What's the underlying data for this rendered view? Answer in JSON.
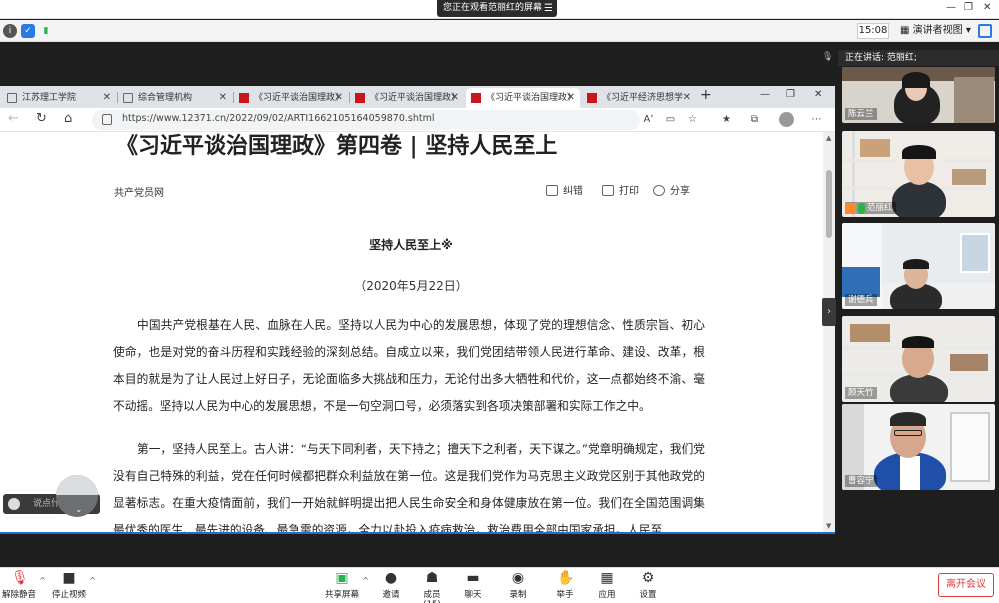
{
  "topbar": {
    "viewing_banner": "您正在观看范丽红的屏幕",
    "banner_menu": "☰",
    "time": "15:08",
    "speaker_view": "演讲者视图"
  },
  "browser": {
    "tabs": [
      {
        "label": "江苏理工学院",
        "favicon": "doc"
      },
      {
        "label": "综合管理机构",
        "favicon": "doc"
      },
      {
        "label": "《习近平谈治国理政》",
        "favicon": "red"
      },
      {
        "label": "《习近平谈治国理政》",
        "favicon": "red"
      },
      {
        "label": "《习近平谈治国理政》",
        "favicon": "red",
        "active": true
      },
      {
        "label": "《习近平经济思想学",
        "favicon": "red"
      }
    ],
    "url": "https://www.12371.cn/2022/09/02/ARTI1662105164059870.shtml",
    "read_aloud_label": "Aʼ"
  },
  "article": {
    "title": "《习近平谈治国理政》第四卷 | 坚持人民至上",
    "source": "共产党员网",
    "actions": {
      "correct": "纠错",
      "print": "打印",
      "share": "分享"
    },
    "subtitle": "坚持人民至上※",
    "date": "（2020年5月22日）",
    "para1": "中国共产党根基在人民、血脉在人民。坚持以人民为中心的发展思想，体现了党的理想信念、性质宗旨、初心使命，也是对党的奋斗历程和实践经验的深刻总结。自成立以来，我们党团结带领人民进行革命、建设、改革，根本目的就是为了让人民过上好日子，无论面临多大挑战和压力，无论付出多大牺牲和代价，这一点都始终不渝、毫不动摇。坚持以人民为中心的发展思想，不是一句空洞口号，必须落实到各项决策部署和实际工作之中。",
    "para2": "第一，坚持人民至上。古人讲：“与天下同利者，天下持之；擅天下之利者，天下谋之。”党章明确规定，我们党没有自己特殊的利益，党在任何时候都把群众利益放在第一位。这是我们党作为马克思主义政党区别于其他政党的显著标志。在重大疫情面前，我们一开始就鲜明提出把人民生命安全和身体健康放在第一位。我们在全国范围调集最优秀的医生、最先进的设备、最急需的资源，全力以赴投入疫病救治，救治费用全部由国家承担。人民至"
  },
  "chat": {
    "placeholder": "说点什么..."
  },
  "panel": {
    "speaking_label": "正在讲话: 范丽红;",
    "participants": [
      {
        "name": "陈云兰"
      },
      {
        "name": "范丽红"
      },
      {
        "name": "谢德兵"
      },
      {
        "name": "顾天竹"
      },
      {
        "name": "曹容宁"
      }
    ]
  },
  "toolbar": {
    "mute": "解除静音",
    "stop_video": "停止视频",
    "share_screen": "共享屏幕",
    "invite": "邀请",
    "members": "成员(15)",
    "chat": "聊天",
    "record": "录制",
    "raise_hand": "举手",
    "apps": "应用",
    "settings": "设置",
    "leave": "离开会议"
  },
  "colors": {
    "accent": "#1f6fd0",
    "danger": "#e03b3b",
    "party_red": "#c8161d"
  }
}
